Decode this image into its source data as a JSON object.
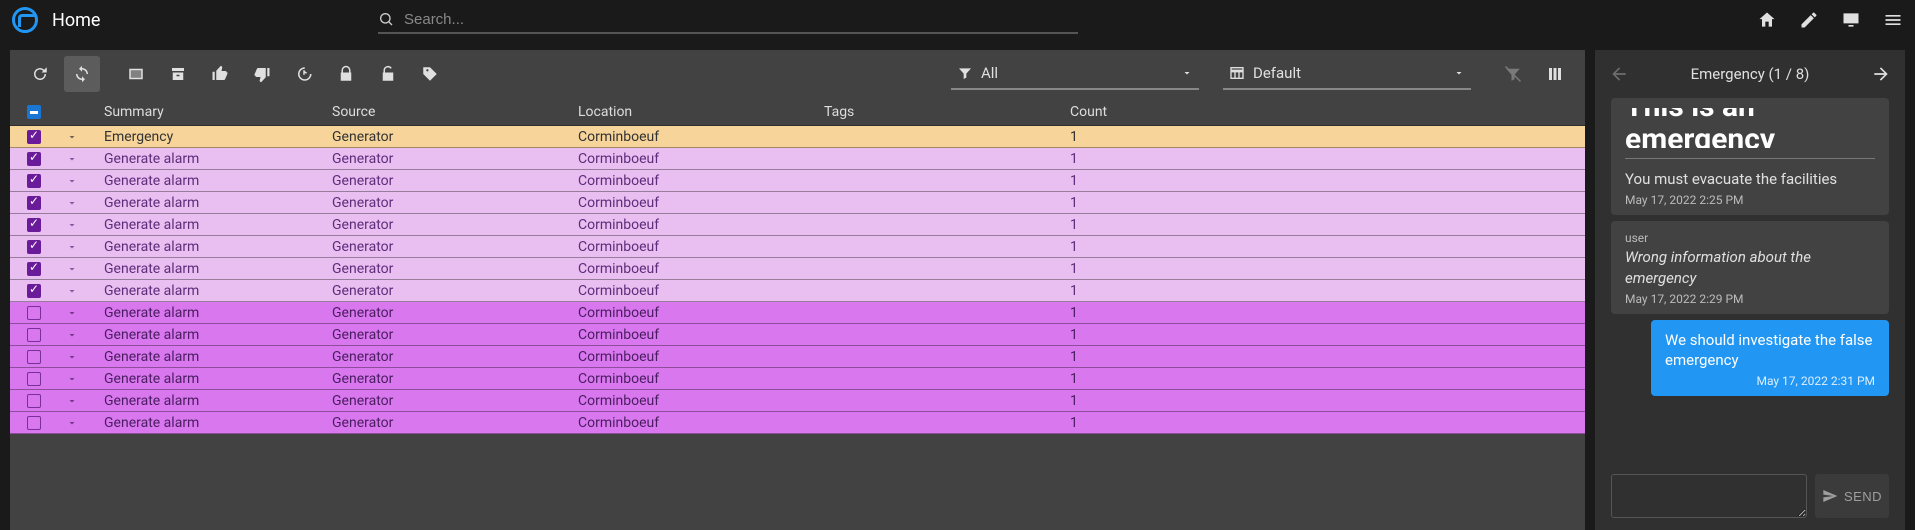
{
  "header": {
    "title": "Home",
    "search_placeholder": "Search..."
  },
  "toolbar": {
    "filter_label": "All",
    "layout_label": "Default"
  },
  "table": {
    "columns": {
      "summary": "Summary",
      "source": "Source",
      "location": "Location",
      "tags": "Tags",
      "count": "Count"
    },
    "rows": [
      {
        "checked": true,
        "kind": "hi",
        "summary": "Emergency",
        "source": "Generator",
        "location": "Corminboeuf",
        "tags": "",
        "count": "1"
      },
      {
        "checked": true,
        "kind": "lo",
        "summary": "Generate alarm",
        "source": "Generator",
        "location": "Corminboeuf",
        "tags": "",
        "count": "1"
      },
      {
        "checked": true,
        "kind": "lo",
        "summary": "Generate alarm",
        "source": "Generator",
        "location": "Corminboeuf",
        "tags": "",
        "count": "1"
      },
      {
        "checked": true,
        "kind": "lo",
        "summary": "Generate alarm",
        "source": "Generator",
        "location": "Corminboeuf",
        "tags": "",
        "count": "1"
      },
      {
        "checked": true,
        "kind": "lo",
        "summary": "Generate alarm",
        "source": "Generator",
        "location": "Corminboeuf",
        "tags": "",
        "count": "1"
      },
      {
        "checked": true,
        "kind": "lo",
        "summary": "Generate alarm",
        "source": "Generator",
        "location": "Corminboeuf",
        "tags": "",
        "count": "1"
      },
      {
        "checked": true,
        "kind": "lo",
        "summary": "Generate alarm",
        "source": "Generator",
        "location": "Corminboeuf",
        "tags": "",
        "count": "1"
      },
      {
        "checked": true,
        "kind": "lo",
        "summary": "Generate alarm",
        "source": "Generator",
        "location": "Corminboeuf",
        "tags": "",
        "count": "1"
      },
      {
        "checked": false,
        "kind": "lo2",
        "summary": "Generate alarm",
        "source": "Generator",
        "location": "Corminboeuf",
        "tags": "",
        "count": "1"
      },
      {
        "checked": false,
        "kind": "lo2",
        "summary": "Generate alarm",
        "source": "Generator",
        "location": "Corminboeuf",
        "tags": "",
        "count": "1"
      },
      {
        "checked": false,
        "kind": "lo2",
        "summary": "Generate alarm",
        "source": "Generator",
        "location": "Corminboeuf",
        "tags": "",
        "count": "1"
      },
      {
        "checked": false,
        "kind": "lo2",
        "summary": "Generate alarm",
        "source": "Generator",
        "location": "Corminboeuf",
        "tags": "",
        "count": "1"
      },
      {
        "checked": false,
        "kind": "lo2",
        "summary": "Generate alarm",
        "source": "Generator",
        "location": "Corminboeuf",
        "tags": "",
        "count": "1"
      },
      {
        "checked": false,
        "kind": "lo2",
        "summary": "Generate alarm",
        "source": "Generator",
        "location": "Corminboeuf",
        "tags": "",
        "count": "1"
      }
    ]
  },
  "detail": {
    "title": "Emergency (1 / 8)",
    "heading": "This is an emergency",
    "messages": [
      {
        "side": "left",
        "author": "",
        "text": "You must evacuate the facilities",
        "ts": "May 17, 2022 2:25 PM",
        "italic": false
      },
      {
        "side": "left",
        "author": "user",
        "text": "Wrong information about the emergency",
        "ts": "May 17, 2022 2:29 PM",
        "italic": true
      },
      {
        "side": "right",
        "author": "",
        "text": "We should investigate the false emergency",
        "ts": "May 17, 2022 2:31 PM",
        "italic": false
      }
    ],
    "send_label": "SEND"
  }
}
